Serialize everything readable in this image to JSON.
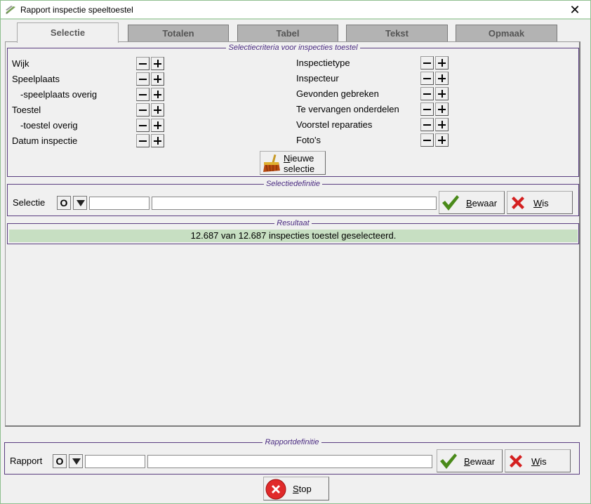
{
  "window": {
    "title": "Rapport inspectie speeltoestel"
  },
  "tabs": [
    {
      "label": "Selectie",
      "active": true
    },
    {
      "label": "Totalen",
      "active": false
    },
    {
      "label": "Tabel",
      "active": false
    },
    {
      "label": "Tekst",
      "active": false
    },
    {
      "label": "Opmaak",
      "active": false
    }
  ],
  "criteria": {
    "title": "Selectiecriteria voor inspecties toestel",
    "left": [
      "Wijk",
      "Speelplaats",
      "-speelplaats overig",
      "Toestel",
      "-toestel overig",
      "Datum inspectie"
    ],
    "right": [
      "Inspectietype",
      "Inspecteur",
      "Gevonden gebreken",
      "Te vervangen onderdelen",
      "Voorstel reparaties",
      "Foto's"
    ],
    "new_selection": {
      "line1": "Nieuwe",
      "line2": "selectie",
      "line1_hotkey": "N",
      "line1_rest": "ieuwe"
    }
  },
  "selectiedef": {
    "title": "Selectiedefinitie",
    "label": "Selectie",
    "o_button": "O",
    "code_value": "",
    "name_value": "",
    "save": {
      "hotkey": "B",
      "rest": "ewaar"
    },
    "clear": {
      "hotkey": "W",
      "rest": "is"
    }
  },
  "result": {
    "title": "Resultaat",
    "text": "12.687 van 12.687 inspecties toestel geselecteerd."
  },
  "rapportdef": {
    "title": "Rapportdefinitie",
    "label": "Rapport",
    "o_button": "O",
    "code_value": "",
    "name_value": "",
    "save": {
      "hotkey": "B",
      "rest": "ewaar"
    },
    "clear": {
      "hotkey": "W",
      "rest": "is"
    }
  },
  "stop": {
    "hotkey": "S",
    "rest": "top"
  },
  "colors": {
    "accent_green": "#4a8a1a",
    "clear_red": "#d42020",
    "group_purple": "#4b2c82",
    "result_bg": "#c7dfc2"
  },
  "icons": {
    "app": "pen-icon",
    "close": "close-icon",
    "broom": "broom-icon",
    "check": "checkmark-icon",
    "cross": "cross-icon",
    "stop": "stop-icon"
  }
}
